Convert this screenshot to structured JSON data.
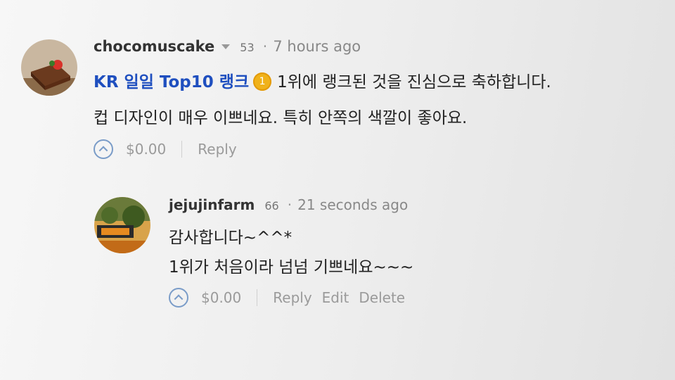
{
  "parent": {
    "author": "chocomuscake",
    "reputation": "53",
    "time": "7 hours ago",
    "link_text": "KR 일일 Top10 랭크",
    "medal": "1",
    "line1_rest": "1위에 랭크된 것을 진심으로 축하합니다.",
    "line2": "컵 디자인이 매우 이쁘네요. 특히 안쪽의 색깔이 좋아요.",
    "payout": "$0.00",
    "reply_label": "Reply"
  },
  "reply": {
    "author": "jejujinfarm",
    "reputation": "66",
    "time": "21 seconds ago",
    "line1": "감사합니다~^^*",
    "line2": "1위가 처음이라 넘넘 기쁘네요~~~",
    "payout": "$0.00",
    "reply_label": "Reply",
    "edit_label": "Edit",
    "delete_label": "Delete"
  },
  "separator_dot": "·",
  "colors": {
    "link": "#1f4fbf",
    "medal": "#f0b21a",
    "vote_icon": "#7a9cc8"
  }
}
